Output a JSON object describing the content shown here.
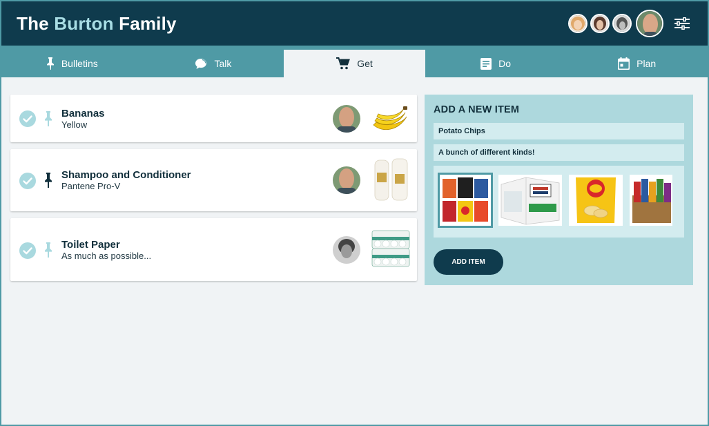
{
  "header": {
    "title_main": "The",
    "title_accent": "Burton",
    "title_rest": "Family",
    "members": [
      "member-1-avatar",
      "member-2-avatar",
      "member-3-avatar"
    ],
    "current_user": "current-user-avatar"
  },
  "tabs": [
    {
      "label": "Bulletins",
      "icon": "pushpin-icon"
    },
    {
      "label": "Talk",
      "icon": "chat-bubble-icon"
    },
    {
      "label": "Get",
      "icon": "cart-icon",
      "active": true
    },
    {
      "label": "Do",
      "icon": "note-icon"
    },
    {
      "label": "Plan",
      "icon": "calendar-icon"
    }
  ],
  "items": [
    {
      "title": "Bananas",
      "subtitle": "Yellow",
      "pinned": false
    },
    {
      "title": "Shampoo and Conditioner",
      "subtitle": "Pantene Pro-V",
      "pinned": true
    },
    {
      "title": "Toilet Paper",
      "subtitle": "As much as possible...",
      "pinned": false
    }
  ],
  "new_item": {
    "heading": "ADD A NEW ITEM",
    "name_value": "Potato Chips",
    "description_value": "A bunch of different kinds!",
    "button_label": "ADD ITEM"
  },
  "colors": {
    "header_bg": "#0f3b4d",
    "tab_bar": "#4f9aa5",
    "panel_bg": "#add8dd",
    "field_bg": "#d3ecef",
    "check": "#a9d9df"
  }
}
